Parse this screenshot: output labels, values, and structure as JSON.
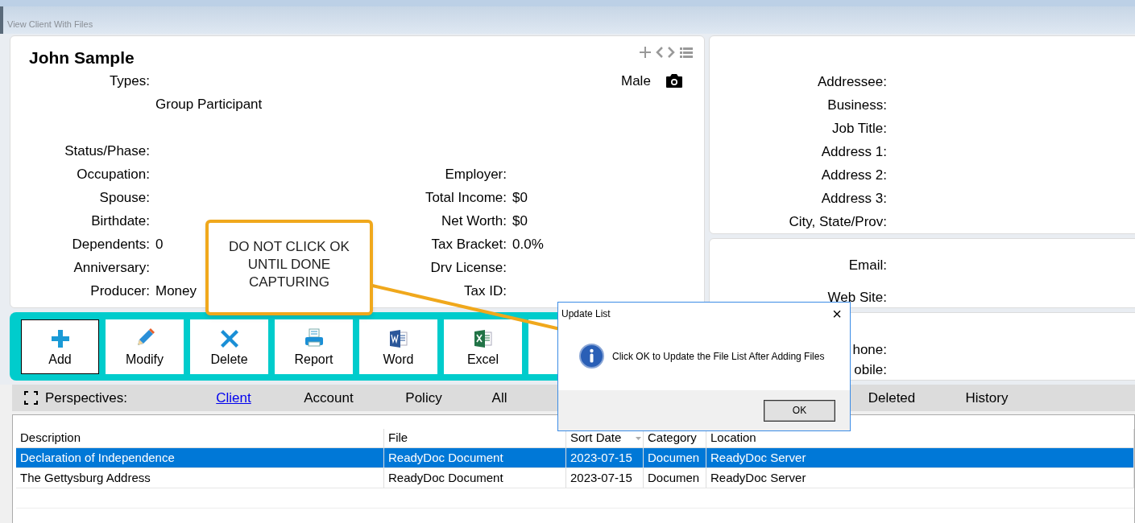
{
  "window": {
    "title": "View Client With Files"
  },
  "client": {
    "name": "John Sample",
    "gender": "Male",
    "types_label": "Types:",
    "types": [
      "Group Participant"
    ],
    "fields": [
      {
        "label": "Status/Phase:"
      },
      {
        "label": "Occupation:"
      },
      {
        "label": "Spouse:"
      },
      {
        "label": "Birthdate:"
      },
      {
        "label": "Dependents:",
        "value": "0"
      },
      {
        "label": "Anniversary:"
      },
      {
        "label": "Producer:",
        "value": "Money"
      }
    ],
    "financial_fields": [
      {
        "label": "Employer:"
      },
      {
        "label": "Total Income:",
        "value": "$0"
      },
      {
        "label": "Net Worth:",
        "value": "$0"
      },
      {
        "label": "Tax Bracket:",
        "value": "0.0%"
      },
      {
        "label": "Drv License:"
      },
      {
        "label": "Tax ID:"
      }
    ]
  },
  "address_fields": [
    "Addressee:",
    "Business:",
    "Job Title:",
    "Address 1:",
    "Address 2:",
    "Address 3:",
    "City, State/Prov:"
  ],
  "contact_fields": [
    "Email:",
    "Web Site:"
  ],
  "phone_fields": [
    "hone:",
    "obile:"
  ],
  "toolbar": [
    {
      "label": "Add",
      "kind": "add",
      "focused": true
    },
    {
      "label": "Modify",
      "kind": "modify",
      "focused": false
    },
    {
      "label": "Delete",
      "kind": "delete",
      "focused": false
    },
    {
      "label": "Report",
      "kind": "report",
      "focused": false
    },
    {
      "label": "Word",
      "kind": "word",
      "focused": false
    },
    {
      "label": "Excel",
      "kind": "excel",
      "focused": false
    },
    {
      "kind": "blank",
      "focused": false
    }
  ],
  "perspectives": {
    "label": "Perspectives:",
    "tabs": [
      {
        "label": "Client",
        "selected": true
      },
      {
        "label": "Account",
        "selected": false
      },
      {
        "label": "Policy",
        "selected": false
      },
      {
        "label": "All",
        "selected": false
      },
      {
        "label": "Deleted",
        "selected": false
      },
      {
        "label": "History",
        "selected": false
      }
    ]
  },
  "table": {
    "columns": [
      "Description",
      "File",
      "Sort Date",
      "Category",
      "Location"
    ],
    "rows": [
      {
        "cells": [
          "Declaration of Independence",
          "ReadyDoc Document",
          "2023-07-15",
          "Documen",
          "ReadyDoc Server"
        ],
        "selected": true
      },
      {
        "cells": [
          "The Gettysburg Address",
          "ReadyDoc Document",
          "2023-07-15",
          "Documen",
          "ReadyDoc Server"
        ],
        "selected": false
      }
    ]
  },
  "callout": {
    "lines": [
      "DO NOT CLICK OK",
      "UNTIL DONE",
      "CAPTURING"
    ]
  },
  "dialog": {
    "title": "Update List",
    "close": "×",
    "message": "Click OK to Update the File List After Adding Files",
    "button": "OK"
  }
}
